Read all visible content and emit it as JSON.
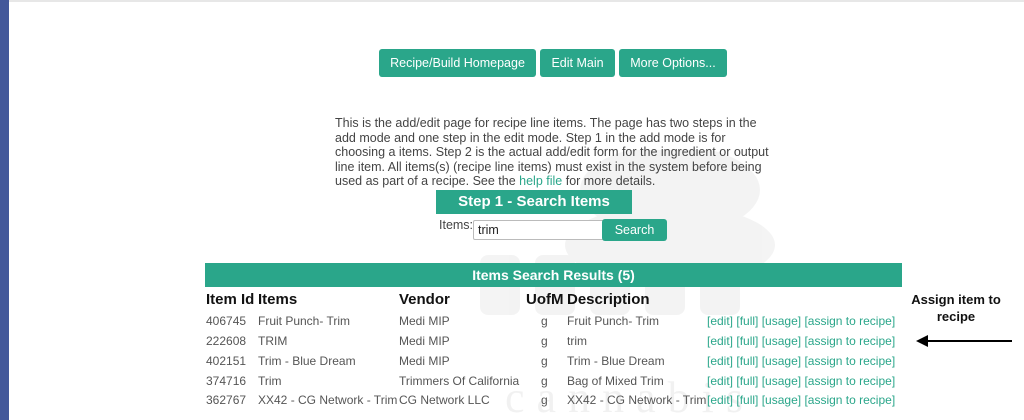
{
  "nav": {
    "recipe_home": "Recipe/Build Homepage",
    "edit_main": "Edit Main",
    "more_options": "More Options..."
  },
  "intro": {
    "text_before_link": "This is the add/edit page for recipe line items. The page has two steps in the add mode and one step in the edit mode. Step 1 in the add mode is for choosing a items. Step 2 is the actual add/edit form for the ingredient or output line item. All items(s) (recipe line items) must exist in the system before being used as part of a recipe. See the ",
    "link_text": "help file",
    "text_after_link": " for more details."
  },
  "step1": {
    "title": "Step 1 - Search Items",
    "items_label": "Items:",
    "search_value": "trim",
    "search_button": "Search"
  },
  "results": {
    "title": "Items Search Results (5)",
    "columns": {
      "id": "Item Id",
      "items": "Items",
      "vendor": "Vendor",
      "uofm": "UofM",
      "description": "Description"
    },
    "action_labels": {
      "edit": "[edit]",
      "full": "[full]",
      "usage": "[usage]",
      "assign": "[assign to recipe]"
    },
    "rows": [
      {
        "id": "406745",
        "item": "Fruit Punch- Trim",
        "vendor": "Medi MIP",
        "uofm": "g",
        "description": "Fruit Punch- Trim"
      },
      {
        "id": "222608",
        "item": "TRIM",
        "vendor": "Medi MIP",
        "uofm": "g",
        "description": "trim"
      },
      {
        "id": "402151",
        "item": "Trim - Blue Dream",
        "vendor": "Medi MIP",
        "uofm": "g",
        "description": "Trim - Blue Dream"
      },
      {
        "id": "374716",
        "item": "Trim",
        "vendor": "Trimmers Of California",
        "uofm": "g",
        "description": "Bag of Mixed Trim"
      },
      {
        "id": "362767",
        "item": "XX42 - CG Network - Trim",
        "vendor": "CG Network LLC",
        "uofm": "g",
        "description": "XX42 - CG Network - Trim"
      }
    ]
  },
  "annotation": {
    "line1": "Assign item to",
    "line2": "recipe"
  },
  "watermark": {
    "text": "cannabis"
  },
  "colors": {
    "accent": "#2aa68a",
    "left_bar": "#43589a"
  }
}
